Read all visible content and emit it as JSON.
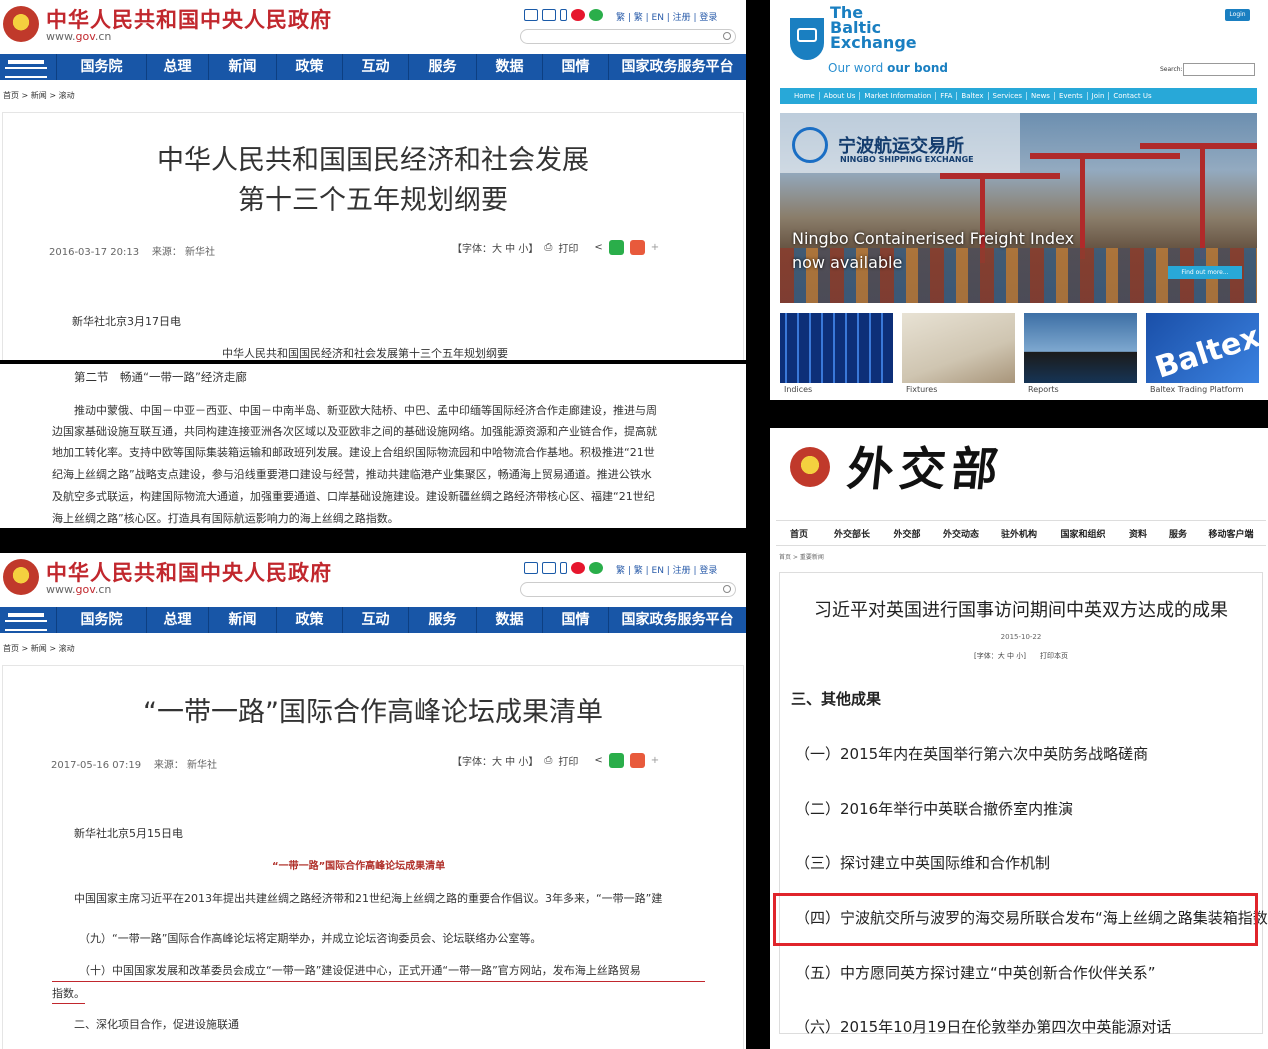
{
  "gov": {
    "site_title": "中华人民共和国中央人民政府",
    "url_prefix": "www.",
    "url_brand": "gov",
    "url_suffix": ".cn",
    "top_links": "繁 | 繁 | EN | 注册 | 登录",
    "nav": [
      "国务院",
      "总理",
      "新闻",
      "政策",
      "互动",
      "服务",
      "数据",
      "国情",
      "国家政务服务平台"
    ],
    "crumb": [
      "首页",
      "新闻",
      "滚动"
    ],
    "tools": {
      "font": "【字体：大 中 小】",
      "print": "打印"
    }
  },
  "article1": {
    "title_line1": "中华人民共和国国民经济和社会发展",
    "title_line2": "第十三个五年规划纲要",
    "datetime": "2016-03-17  20:13",
    "source_label": "来源：",
    "source": "新华社",
    "dateline": "新华社北京3月17日电",
    "subtitle": "中华人民共和国国民经济和社会发展第十三个五年规划纲要",
    "section": "第二节　畅通“一带一路”经济走廊",
    "paragraph": [
      "推动中蒙俄、中国－中亚－西亚、中国－中南半岛、新亚欧大陆桥、中巴、孟中印缅等国际经济合作走廊建设，推进与周",
      "边国家基础设施互联互通，共同构建连接亚洲各次区域以及亚欧非之间的基础设施网络。加强能源资源和产业链合作，提高就",
      "地加工转化率。支持中欧等国际集装箱运输和邮政班列发展。建设上合组织国际物流园和中哈物流合作基地。积极推进“21世",
      "纪海上丝绸之路”战略支点建设，参与沿线重要港口建设与经营，推动共建临港产业集聚区，畅通海上贸易通道。推进公铁水",
      "及航空多式联运，构建国际物流大通道，加强重要通道、口岸基础设施建设。建设新疆丝绸之路经济带核心区、福建“21世纪"
    ],
    "last_line_plain": "海上丝绸之路”核心区。",
    "last_line_highlight": "打造具有国际航运影响力的海上丝绸之路指数。"
  },
  "article2": {
    "title": "“一带一路”国际合作高峰论坛成果清单",
    "datetime": "2017-05-16  07:19",
    "source_label": "来源：",
    "source": "新华社",
    "dateline": "新华社北京5月15日电",
    "subtitle": "“一带一路”国际合作高峰论坛成果清单",
    "intro": "中国国家主席习近平在2013年提出共建丝绸之路经济带和21世纪海上丝绸之路的重要合作倡议。3年多来，“一带一路”建",
    "item9": "（九）“一带一路”国际合作高峰论坛将定期举办，并成立论坛咨询委员会、论坛联络办公室等。",
    "item10_line1": "（十）中国国家发展和改革委员会成立“一带一路”建设促进中心，正式开通“一带一路”官方网站，发布海上丝路贸易",
    "item10_line2": "指数。",
    "section2": "二、深化项目合作，促进设施联通"
  },
  "baltic": {
    "name_line1": "The",
    "name_line2": "Baltic",
    "name_line3": "Exchange",
    "tagline_plain": "Our word ",
    "tagline_bold": "our bond",
    "login": "Login",
    "search_label": "Search:",
    "nav": [
      "Home",
      "About Us",
      "Market Information",
      "FFA",
      "Baltex",
      "Services",
      "News",
      "Events",
      "Join",
      "Contact Us"
    ],
    "hero_cn": "宁波航运交易所",
    "hero_en": "NINGBO SHIPPING EXCHANGE",
    "hero_line1": "Ningbo Containerised Freight Index",
    "hero_line2": "now available",
    "find_out": "Find out more...",
    "thumbs": [
      "Indices",
      "Fixtures",
      "Reports",
      "Baltex Trading Platform"
    ],
    "thumb_brand": "Baltex"
  },
  "mfa": {
    "calligraphy": "外交部",
    "nav": [
      "首页",
      "外交部长",
      "外交部",
      "外交动态",
      "驻外机构",
      "国家和组织",
      "资料",
      "服务",
      "移动客户端"
    ],
    "crumb": "首页 > 重要新闻",
    "title": "习近平对英国进行国事访问期间中英双方达成的成果",
    "date": "2015-10-22",
    "tools": "[字体：大 中 小]　　打印本页",
    "section": "三、其他成果",
    "items": [
      "（一）2015年内在英国举行第六次中英防务战略磋商",
      "（二）2016年举行中英联合撤侨室内推演",
      "（三）探讨建立中英国际维和合作机制",
      "（四）宁波航交所与波罗的海交易所联合发布“海上丝绸之路集装箱指数”",
      "（五）中方愿同英方探讨建立“中英创新合作伙伴关系”",
      "（六）2015年10月19日在伦敦举办第四次中英能源对话"
    ]
  },
  "colors": {
    "gov_red": "#c1272d",
    "gov_blue": "#1856a7",
    "baltic_blue": "#1a7fc1",
    "baltic_cyan": "#28a8d8",
    "highlight_red": "#e0242b"
  }
}
